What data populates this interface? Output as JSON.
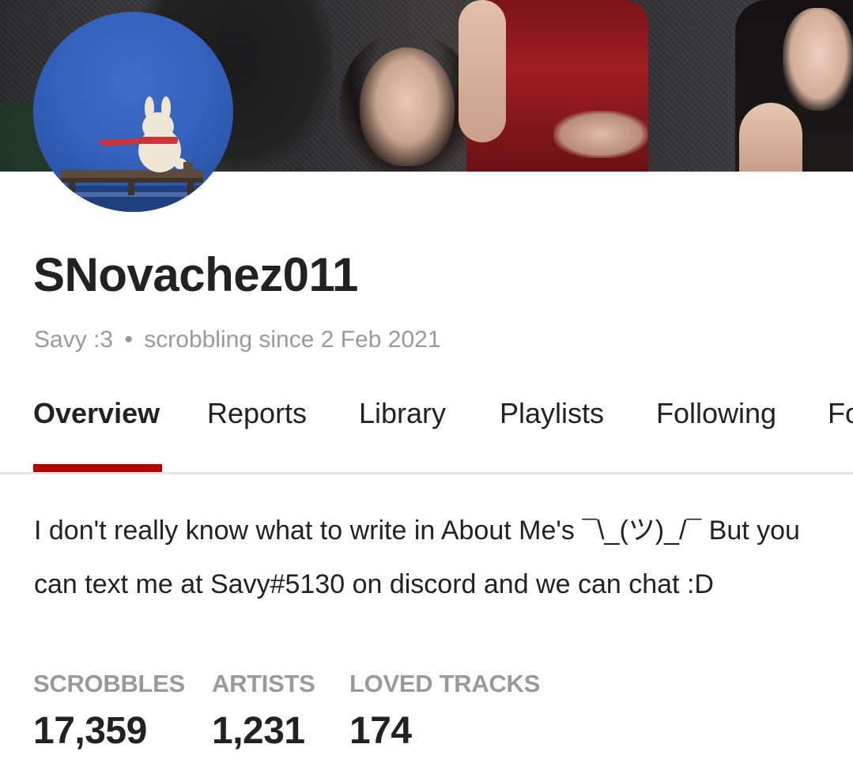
{
  "profile": {
    "username": "SNovachez011",
    "display_name": "Savy :3",
    "separator": "•",
    "since": "scrobbling since 2 Feb 2021"
  },
  "images": {
    "banner": "kpop-group-banner-image",
    "avatar": "bunny-on-bridge-avatar"
  },
  "tabs": [
    {
      "label": "Overview",
      "active": true
    },
    {
      "label": "Reports",
      "active": false
    },
    {
      "label": "Library",
      "active": false
    },
    {
      "label": "Playlists",
      "active": false
    },
    {
      "label": "Following",
      "active": false
    },
    {
      "label": "Fo",
      "active": false
    }
  ],
  "about": "I don't really know what to write in About Me's ¯\\_(ツ)_/¯ But you can text me at Savy#5130 on discord and we can chat :D",
  "stats": [
    {
      "label": "SCROBBLES",
      "value": "17,359"
    },
    {
      "label": "ARTISTS",
      "value": "1,231"
    },
    {
      "label": "LOVED TRACKS",
      "value": "174"
    }
  ],
  "colors": {
    "accent": "#b90000",
    "text": "#222222",
    "muted": "#9a9a9a",
    "divider": "#e4e4e4"
  }
}
